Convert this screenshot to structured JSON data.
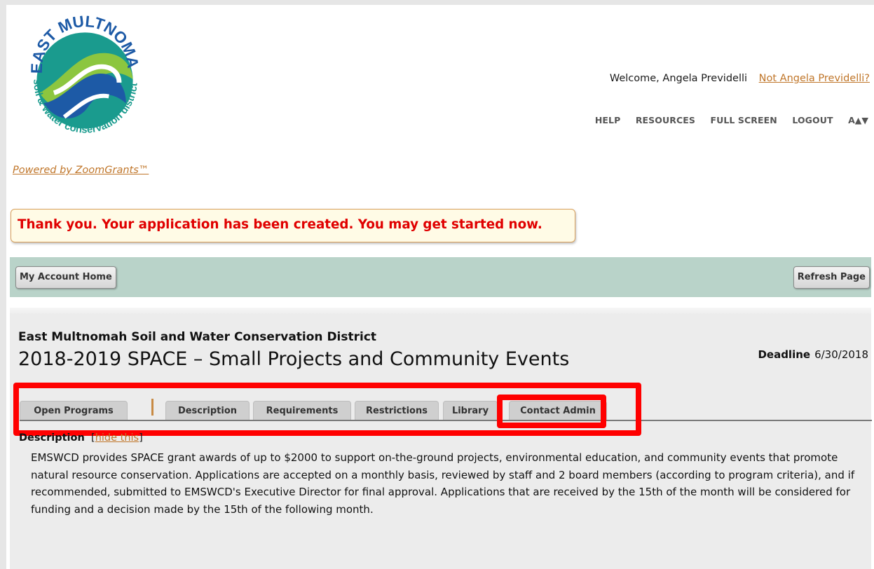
{
  "header": {
    "logo": {
      "top_text": "EAST MULTNOMAH",
      "side_text": "soil & water conservation district"
    },
    "welcome_text": "Welcome, Angela Previdelli",
    "not_user_link": "Not Angela Previdelli?",
    "nav": [
      "HELP",
      "RESOURCES",
      "FULL SCREEN",
      "LOGOUT"
    ],
    "font_size_control": "A▲▼",
    "powered_by": "Powered by ZoomGrants™"
  },
  "message": "Thank you. Your application has been created. You may get started now.",
  "toolbar": {
    "home_label": "My Account Home",
    "refresh_label": "Refresh Page"
  },
  "program": {
    "organization": "East Multnomah Soil and Water Conservation District",
    "title": "2018-2019 SPACE – Small Projects and Community Events",
    "deadline_label": "Deadline",
    "deadline_value": "6/30/2018",
    "tabs": [
      "Open Programs",
      "Description",
      "Requirements",
      "Restrictions",
      "Library",
      "Contact Admin"
    ],
    "description_heading": "Description",
    "hide_link": "hide this",
    "description_text": "EMSWCD provides SPACE grant awards of up to $2000 to support on-the-ground projects, environmental education, and community events that promote natural resource conservation. Applications are accepted on a monthly basis, reviewed by staff and 2 board members (according to program criteria), and if recommended, submitted to EMSWCD's Executive Director for final approval. Applications that are received by the 15th of the month will be considered for funding and a decision made by the 15th of the following month."
  },
  "colors": {
    "accent_link": "#c0762a",
    "message_text": "#e00000",
    "toolbar_bg": "#b9d3c9",
    "highlight": "#ff0000",
    "logo_teal": "#1a9b8e",
    "logo_blue": "#1d5aa6",
    "logo_green": "#8cc63f"
  }
}
